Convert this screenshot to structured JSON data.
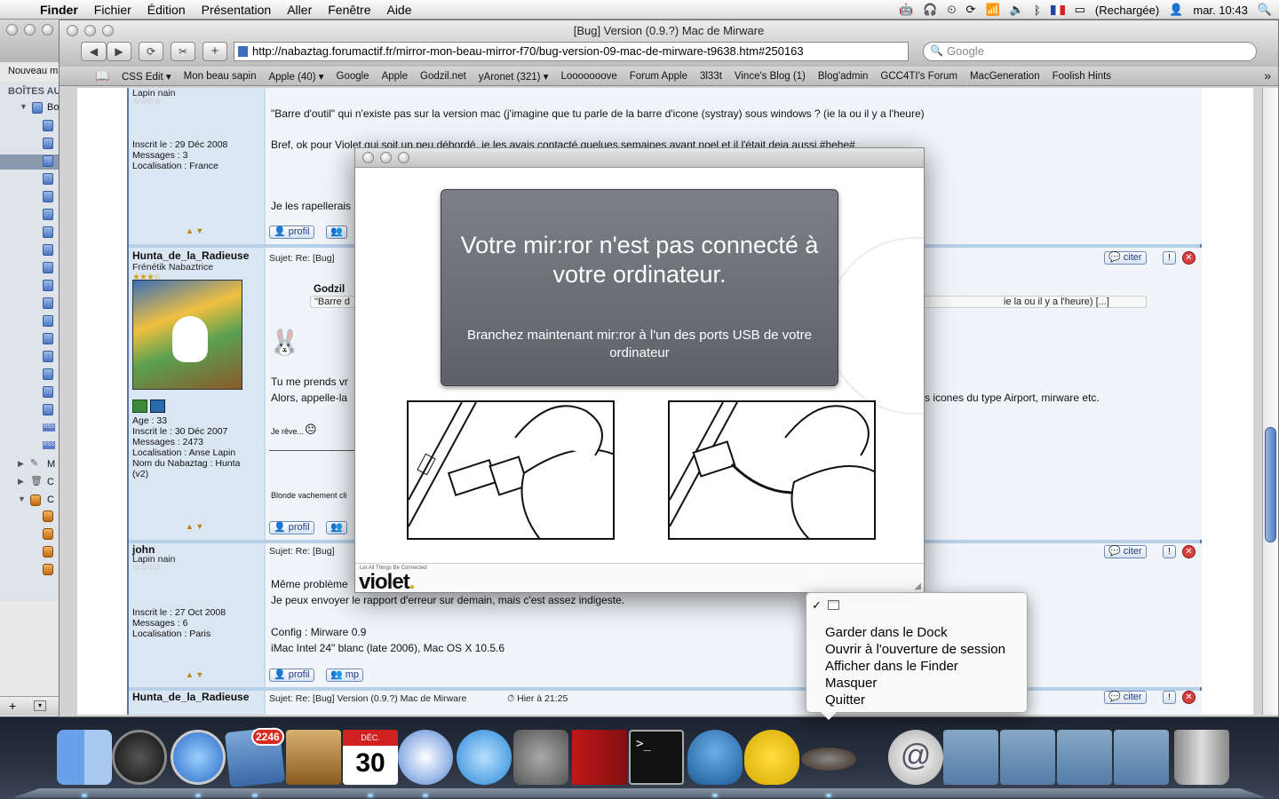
{
  "menubar": {
    "app": "Finder",
    "items": [
      "Fichier",
      "Édition",
      "Présentation",
      "Aller",
      "Fenêtre",
      "Aide"
    ],
    "battery": "(Rechargée)",
    "clock": "mar. 10:43"
  },
  "finder": {
    "new_label": "Nouveau m",
    "boxes_label": "BOÎTES AU",
    "item_bo": "Bo",
    "item_m": "M",
    "item_c1": "C",
    "item_c2": "C"
  },
  "browser": {
    "title": "[Bug] Version (0.9.?) Mac de Mirware",
    "url": "http://nabaztag.forumactif.fr/mirror-mon-beau-mirror-f70/bug-version-09-mac-de-mirware-t9638.htm#250163",
    "search_placeholder": "Google",
    "bookmarks": [
      "CSS Edit ▾",
      "Mon beau sapin",
      "Apple (40) ▾",
      "Google",
      "Apple",
      "Godzil.net",
      "yAronet (321) ▾",
      "Looooooove",
      "Forum Apple",
      "3l33t",
      "Vince's Blog (1)",
      "Blog'admin",
      "GCC4TI's Forum",
      "MacGeneration",
      "Foolish Hints"
    ]
  },
  "forum": {
    "post1": {
      "rank_top": "Lapin nain",
      "info": "Inscrit le : 29 Déc 2008\nMessages : 3\nLocalisation : France",
      "line1": "\"Barre d'outil\" qui n'existe pas sur la version mac (j'imagine que tu parle de la barre d'icone (systray) sous windows ? (ie la ou il y a l'heure)",
      "line2": "Bref, ok pour Violet qui soit un peu débordé, je les avais contacté quelues semaines avant noel et il l'était deja aussi #hehe#",
      "line3": "Je les rapellerais",
      "btn_profil": "profil"
    },
    "post2": {
      "username": "Hunta_de_la_Radieuse",
      "rank": "Frénétik Nabaztrice",
      "subject": "Sujet:  Re:  [Bug]",
      "quote_author": "Godzil",
      "quote_text": "\"Barre d",
      "quote_tail": "ie la ou il y a l'heure) [...]",
      "line1": "Tu me prends vr",
      "line2": "Alors, appelle-la",
      "line2_tail": "s icones du type Airport, mirware etc.",
      "reve": "Je rêve...",
      "signature": "Blonde vachement cli",
      "info": "Age : 33\nInscrit le : 30 Déc 2007\nMessages : 2473\nLocalisation : Anse Lapin\nNom du Nabaztag : Hunta\n(v2)",
      "btn_citer": "citer",
      "btn_profil": "profil"
    },
    "post3": {
      "username": "john",
      "rank": "Lapin nain",
      "subject": "Sujet:  Re:  [Bug]",
      "line1": "Même problème",
      "line2": "Je peux envoyer le rapport d'erreur sur demain, mais c'est assez indigeste.",
      "line3": "Config : Mirware 0.9",
      "line4": "iMac Intel 24\" blanc (late 2006), Mac OS X 10.5.6",
      "info": "Inscrit le : 27 Oct 2008\nMessages : 6\nLocalisation : Paris",
      "btn_citer": "citer",
      "btn_profil": "profil",
      "btn_mp": "mp"
    },
    "post4": {
      "username": "Hunta_de_la_Radieuse",
      "subject": "Sujet:  Re:  [Bug]  Version (0.9.?) Mac de Mirware",
      "time": "Hier à 21:25",
      "btn_citer": "citer"
    }
  },
  "dialog": {
    "heading": "Votre mir:ror n'est pas connecté à votre ordinateur.",
    "message": "Branchez maintenant mir:ror à l'un des ports USB de votre ordinateur",
    "tagline": "Let All Things Be Connected",
    "logo": "violet"
  },
  "context_menu": {
    "items": [
      "Garder dans le Dock",
      "Ouvrir à l'ouverture de session",
      "Afficher dans le Finder",
      "Masquer",
      "Quitter"
    ]
  },
  "dock": {
    "mail_badge": "2246",
    "ical_month": "DÉC.",
    "ical_day": "30",
    "apps": [
      "finder-icon",
      "dashboard-icon",
      "safari-icon",
      "mail-icon",
      "address-book-icon",
      "ical-icon",
      "itunes-icon",
      "quicktime-icon",
      "system-preferences-icon",
      "photo-booth-icon",
      "terminal-icon",
      "adium-icon",
      "cyberduck-icon",
      "mirware-icon",
      "mail-server-icon",
      "applications-folder-icon",
      "folder-icon",
      "documents-folder-icon",
      "downloads-folder-icon",
      "trash-icon"
    ]
  }
}
